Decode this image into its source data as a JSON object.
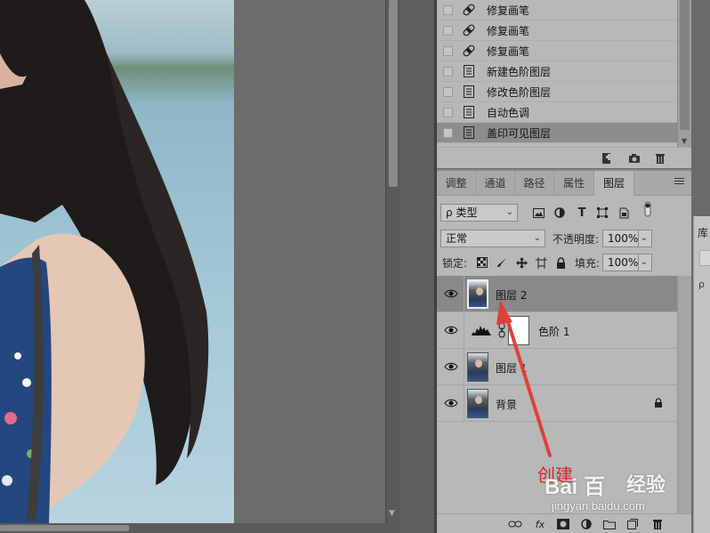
{
  "history": {
    "items": [
      {
        "label": "修复画笔",
        "icon": "healing-brush-icon",
        "active": false
      },
      {
        "label": "修复画笔",
        "icon": "healing-brush-icon",
        "active": false
      },
      {
        "label": "修复画笔",
        "icon": "healing-brush-icon",
        "active": false
      },
      {
        "label": "新建色阶图层",
        "icon": "document-icon",
        "active": false
      },
      {
        "label": "修改色阶图层",
        "icon": "document-icon",
        "active": false
      },
      {
        "label": "自动色调",
        "icon": "document-icon",
        "active": false
      },
      {
        "label": "盖印可见图层",
        "icon": "document-icon",
        "active": true
      }
    ]
  },
  "tabs": [
    "调整",
    "通道",
    "路径",
    "属性",
    "图层"
  ],
  "active_tab": "图层",
  "layers_panel": {
    "filter_kind": "类型",
    "blend_mode": "正常",
    "opacity_label": "不透明度:",
    "opacity_value": "100%",
    "lock_label": "锁定:",
    "fill_label": "填充:",
    "fill_value": "100%"
  },
  "layers": [
    {
      "name": "图层 2",
      "type": "pixel",
      "selected": true,
      "locked": false
    },
    {
      "name": "色阶 1",
      "type": "adjustment",
      "selected": false,
      "locked": false
    },
    {
      "name": "图层 1",
      "type": "pixel",
      "selected": false,
      "locked": false
    },
    {
      "name": "背景",
      "type": "pixel",
      "selected": false,
      "locked": true
    }
  ],
  "annotation": {
    "text": "创建",
    "color": "#d42a2a"
  },
  "watermark": {
    "logo": "Bai 百",
    "brand_cn": "经验",
    "url": "jingyan.baidu.com"
  },
  "right_panel": {
    "title": "库",
    "search_glyph": "ρ"
  }
}
